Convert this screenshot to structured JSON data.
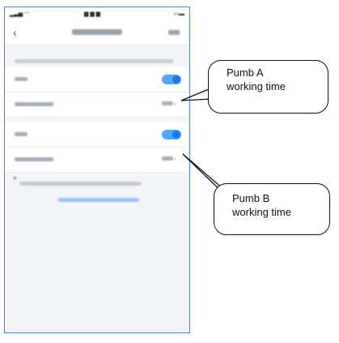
{
  "callouts": {
    "pump_a": {
      "line1": "Pumb A",
      "line2": "working time"
    },
    "pump_b": {
      "line1": "Pumb B",
      "line2": "working time"
    }
  },
  "phone": {
    "toggles": [
      {
        "state": "on"
      },
      {
        "state": "on"
      }
    ]
  },
  "colors": {
    "toggle_on": "#1a78f2",
    "toggle_track": "#52a8ff",
    "phone_border": "#5b7fc9",
    "callout_border": "#111111"
  }
}
